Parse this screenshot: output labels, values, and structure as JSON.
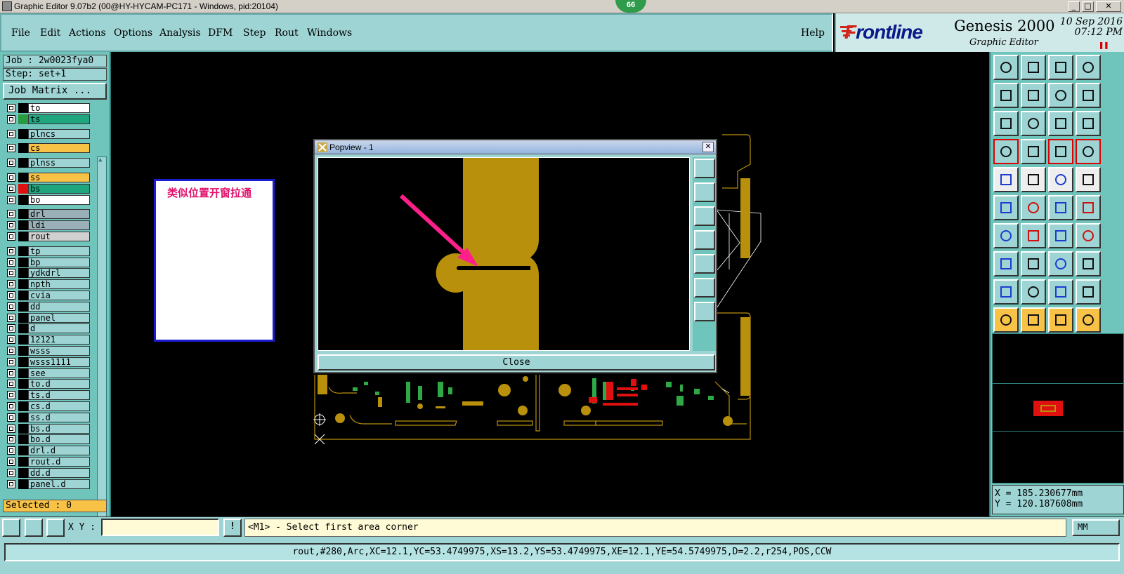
{
  "window": {
    "title": "Graphic Editor 9.07b2 (00@HY-HYCAM-PC171 - Windows, pid:20104)",
    "badge": "66",
    "min": "_",
    "max": "□",
    "close": "✕"
  },
  "menu": {
    "items": [
      "File",
      "Edit",
      "Actions",
      "Options",
      "Analysis",
      "DFM",
      "Step",
      "Rout",
      "Windows"
    ],
    "help": "Help"
  },
  "brand": {
    "logo_f": "F",
    "logo_rest": "rontline",
    "product": "Genesis 2000",
    "subtitle": "Graphic Editor",
    "date": "10 Sep 2016",
    "time": "07:12 PM"
  },
  "job": {
    "job": "Job : 2w0023fya0",
    "step": "Step: set+1",
    "job_matrix": "Job Matrix ..."
  },
  "layers": [
    {
      "name": "to",
      "color": "#ffffff",
      "swatch": "#000000",
      "group": 0
    },
    {
      "name": "ts",
      "color": "#1fa67e",
      "swatch": "#2a9a42",
      "group": 0
    },
    {
      "name": "plncs",
      "color": "#9ed4d4",
      "swatch": "#000000",
      "group": 1
    },
    {
      "name": "cs",
      "color": "#f7c246",
      "swatch": "#000000",
      "group": 2
    },
    {
      "name": "plnss",
      "color": "#9ed4d4",
      "swatch": "#000000",
      "group": 3
    },
    {
      "name": "ss",
      "color": "#f7c246",
      "swatch": "#000000",
      "group": 4
    },
    {
      "name": "bs",
      "color": "#1fa67e",
      "swatch": "#e01010",
      "group": 4
    },
    {
      "name": "bo",
      "color": "#ffffff",
      "swatch": "#000000",
      "group": 4
    },
    {
      "name": "drl",
      "color": "#9ab0b8",
      "swatch": "#000000",
      "group": 5
    },
    {
      "name": "ldi",
      "color": "#9ab0b8",
      "swatch": "#000000",
      "group": 5
    },
    {
      "name": "rout",
      "color": "#d0d0d0",
      "swatch": "#000000",
      "group": 5
    },
    {
      "name": "tp",
      "color": "#9ed4d4",
      "swatch": "#000000",
      "group": 6
    },
    {
      "name": "bp",
      "color": "#9ed4d4",
      "swatch": "#000000",
      "group": 6
    },
    {
      "name": "ydkdrl",
      "color": "#9ed4d4",
      "swatch": "#000000",
      "group": 6
    },
    {
      "name": "npth",
      "color": "#9ed4d4",
      "swatch": "#000000",
      "group": 6
    },
    {
      "name": "cvia",
      "color": "#9ed4d4",
      "swatch": "#000000",
      "group": 6
    },
    {
      "name": "dd",
      "color": "#9ed4d4",
      "swatch": "#000000",
      "group": 6
    },
    {
      "name": "panel",
      "color": "#9ed4d4",
      "swatch": "#000000",
      "group": 6
    },
    {
      "name": "d",
      "color": "#9ed4d4",
      "swatch": "#000000",
      "group": 6
    },
    {
      "name": "12121",
      "color": "#9ed4d4",
      "swatch": "#000000",
      "group": 6
    },
    {
      "name": "wsss",
      "color": "#9ed4d4",
      "swatch": "#000000",
      "group": 6
    },
    {
      "name": "wsss1111",
      "color": "#9ed4d4",
      "swatch": "#000000",
      "group": 6
    },
    {
      "name": "see",
      "color": "#9ed4d4",
      "swatch": "#000000",
      "group": 6
    },
    {
      "name": "to.d",
      "color": "#9ed4d4",
      "swatch": "#000000",
      "group": 6
    },
    {
      "name": "ts.d",
      "color": "#9ed4d4",
      "swatch": "#000000",
      "group": 6
    },
    {
      "name": "cs.d",
      "color": "#9ed4d4",
      "swatch": "#000000",
      "group": 6
    },
    {
      "name": "ss.d",
      "color": "#9ed4d4",
      "swatch": "#000000",
      "group": 6
    },
    {
      "name": "bs.d",
      "color": "#9ed4d4",
      "swatch": "#000000",
      "group": 6
    },
    {
      "name": "bo.d",
      "color": "#9ed4d4",
      "swatch": "#000000",
      "group": 6
    },
    {
      "name": "drl.d",
      "color": "#9ed4d4",
      "swatch": "#000000",
      "group": 6
    },
    {
      "name": "rout.d",
      "color": "#9ed4d4",
      "swatch": "#000000",
      "group": 6
    },
    {
      "name": "dd.d",
      "color": "#9ed4d4",
      "swatch": "#000000",
      "group": 6
    },
    {
      "name": "panel.d",
      "color": "#9ed4d4",
      "swatch": "#000000",
      "group": 6
    }
  ],
  "selected": "Selected : 0",
  "annotation": {
    "text": "类似位置开窗拉通"
  },
  "popview": {
    "title": "Popview - 1",
    "close": "Close"
  },
  "coords": {
    "x": "X =  185.230677mm",
    "y": "Y =  120.187608mm"
  },
  "cmd": {
    "xy_label": "X Y :",
    "xy_value": "",
    "prompt": "<M1> - Select first area corner",
    "units": "MM"
  },
  "status": "rout,#280,Arc,XC=12.1,YC=53.4749975,XS=13.2,YS=53.4749975,XE=12.1,YE=54.5749975,D=2.2,r254,POS,CCW",
  "colors": {
    "panel": "#9ed4d4",
    "panel_dark": "#6fc4bc",
    "copper": "#b8900c",
    "arrow": "#ff1f8a",
    "note_border": "#1c1ccf",
    "note_text": "#e0116c"
  }
}
